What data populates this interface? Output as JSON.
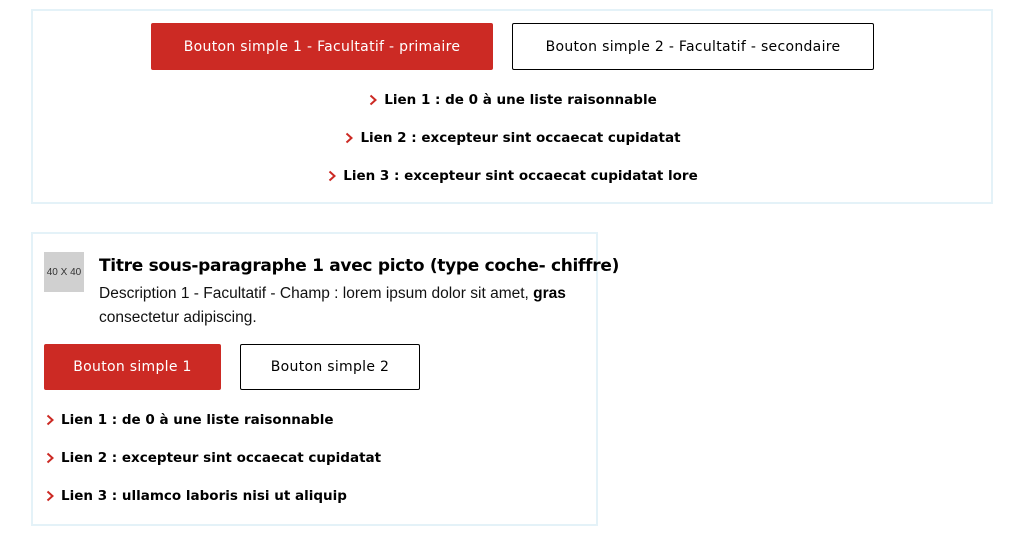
{
  "colors": {
    "primary": "#cc2a24",
    "card_border": "#e4f2f8",
    "chevron": "#cc2a24",
    "picto_bg": "#d0d0d0"
  },
  "block1": {
    "primary_button": "Bouton simple 1 - Facultatif - primaire",
    "secondary_button": "Bouton simple 2 - Facultatif - secondaire",
    "links": [
      {
        "icon": "chevron-right-icon",
        "label": "Lien 1 : de 0 à une liste raisonnable"
      },
      {
        "icon": "chevron-right-icon",
        "label": "Lien 2 : excepteur sint occaecat cupidatat"
      },
      {
        "icon": "chevron-right-icon",
        "label": "Lien 3 : excepteur sint occaecat cupidatat lore"
      }
    ]
  },
  "block2": {
    "picto_label": "40 X 40",
    "title": "Titre sous-paragraphe 1 avec picto (type coche- chiffre)",
    "description_before": "Description 1 - Facultatif - Champ : lorem ipsum dolor sit amet, ",
    "description_bold": "gras",
    "description_after": " consectetur adipiscing.",
    "primary_button": "Bouton simple 1",
    "secondary_button": "Bouton simple 2",
    "links": [
      {
        "icon": "chevron-right-icon",
        "label": "Lien 1 : de 0 à une liste raisonnable"
      },
      {
        "icon": "chevron-right-icon",
        "label": "Lien 2 : excepteur sint occaecat cupidatat"
      },
      {
        "icon": "chevron-right-icon",
        "label": "Lien 3 : ullamco laboris nisi ut aliquip"
      }
    ]
  }
}
